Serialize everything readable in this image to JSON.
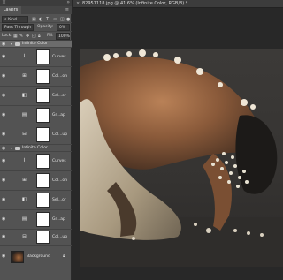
{
  "layers_panel": {
    "tab_label": "Layers",
    "kind_filter": "Kind",
    "blend_mode": "Pass Through",
    "opacity_label": "Opacity:",
    "opacity_value": "0%",
    "lock_label": "Lock:",
    "fill_label": "Fill:",
    "fill_value": "100%",
    "layers": [
      {
        "name": "Infinite Color",
        "type": "group",
        "selected": true
      },
      {
        "name": "Curves",
        "type": "adjustment",
        "icon": "curves-icon"
      },
      {
        "name": "Col...on",
        "type": "adjustment",
        "icon": "color-lookup-icon"
      },
      {
        "name": "Sel...or",
        "type": "adjustment",
        "icon": "selective-color-icon"
      },
      {
        "name": "Gr...ap",
        "type": "adjustment",
        "icon": "gradient-map-icon"
      },
      {
        "name": "Col...up",
        "type": "adjustment",
        "icon": "color-balance-icon"
      },
      {
        "name": "Infinite Color",
        "type": "group",
        "selected": false
      },
      {
        "name": "Curves",
        "type": "adjustment",
        "icon": "curves-icon"
      },
      {
        "name": "Col...on",
        "type": "adjustment",
        "icon": "color-lookup-icon"
      },
      {
        "name": "Sel...or",
        "type": "adjustment",
        "icon": "selective-color-icon"
      },
      {
        "name": "Gr...ap",
        "type": "adjustment",
        "icon": "gradient-map-icon"
      },
      {
        "name": "Col...up",
        "type": "adjustment",
        "icon": "color-balance-icon"
      },
      {
        "name": "Background",
        "type": "background",
        "locked": true
      }
    ]
  },
  "document": {
    "tab_title": "82951118.jpg @ 41.6% (Infinite Color, RGB/8) *"
  }
}
